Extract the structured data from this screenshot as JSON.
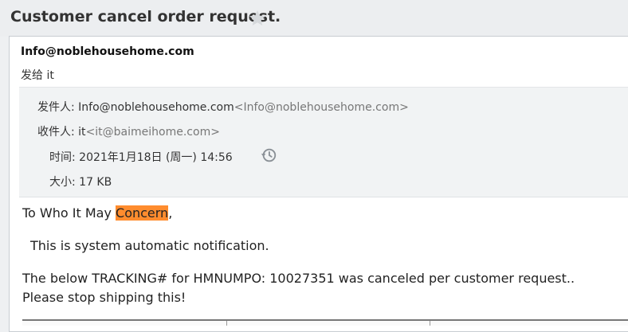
{
  "subject": {
    "title": "Customer cancel order request."
  },
  "header": {
    "sender_name": "Info@noblehousehome.com",
    "sendto_label": "发给",
    "sendto_value": "it"
  },
  "details": {
    "from_label": "发件人:",
    "from_name": "Info@noblehousehome.com",
    "from_addr": "<Info@noblehousehome.com>",
    "to_label": "收件人:",
    "to_name": "it",
    "to_addr": "<it@baimeihome.com>",
    "time_label": "时间:",
    "time_value": "2021年1月18日 (周一) 14:56",
    "size_label": "大小:",
    "size_value": "17 KB"
  },
  "body": {
    "greeting_prefix": "To Who It May ",
    "greeting_highlight": "Concern",
    "greeting_suffix": ",",
    "line1": "This is system automatic notification.",
    "line2": "The below TRACKING# for HMNUMPO: 10027351 was canceled per customer request..",
    "line3": "Please stop shipping this!"
  },
  "colors": {
    "highlight": "#ff8c2e",
    "details_bg": "#f1f3f4",
    "page_bg": "#eef0f2"
  },
  "icons": {
    "star": "star-icon",
    "history": "history-icon"
  }
}
